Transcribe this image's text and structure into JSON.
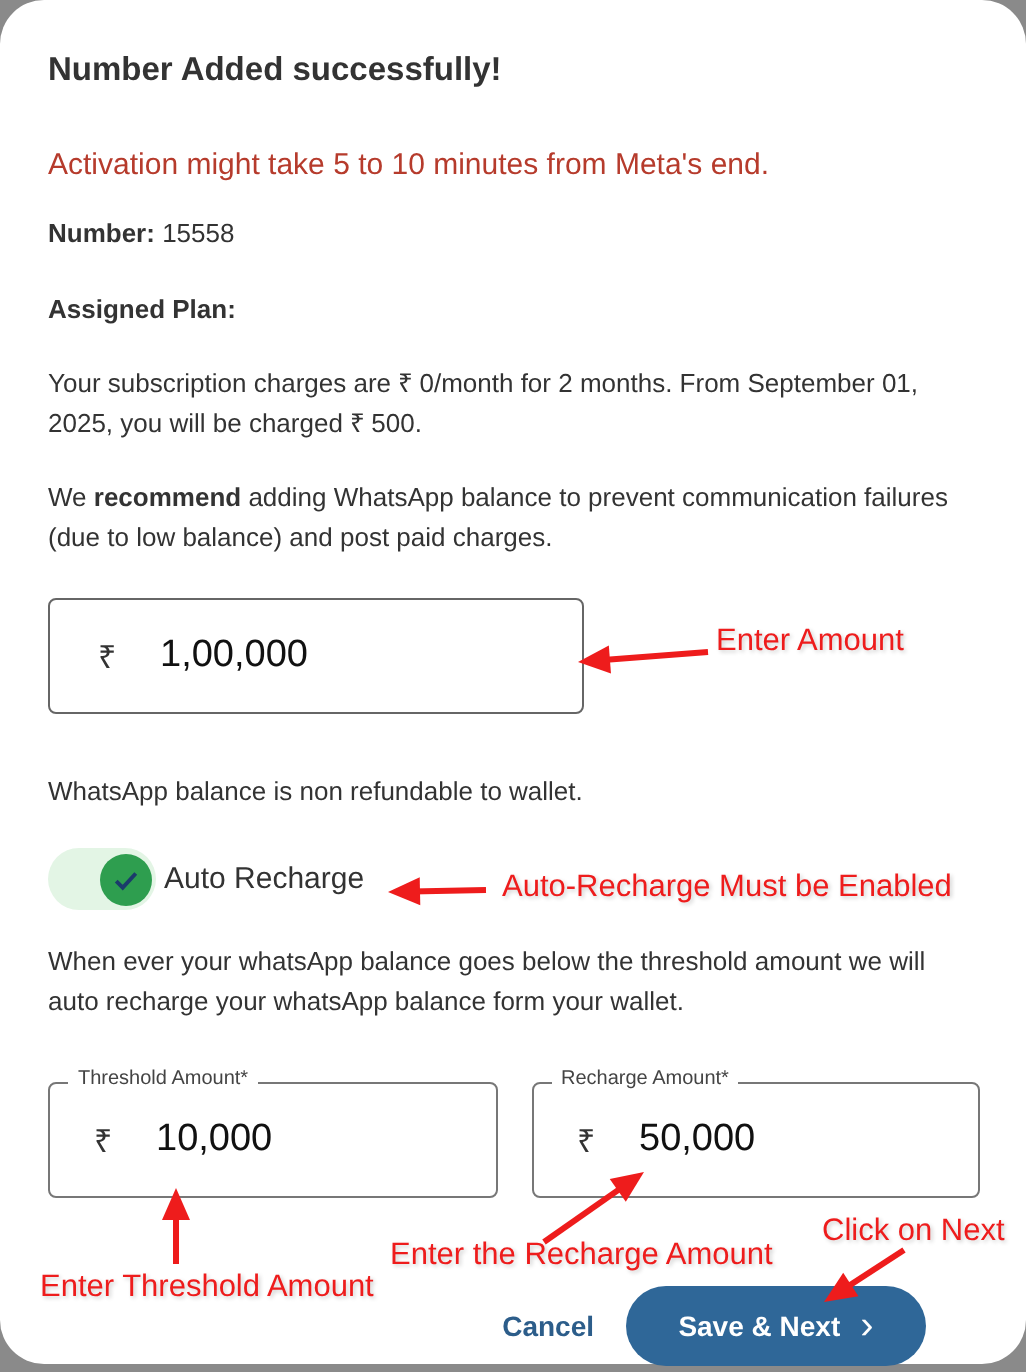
{
  "dialog": {
    "title": "Number Added successfully!",
    "notice": "Activation might take 5 to 10 minutes from Meta's end.",
    "number": "**Number:** 15558",
    "plan_label": "Assigned Plan:",
    "subscription_text": "Your subscription charges are ₹ 0/month for 2 months. From September 01, 2025, you will be charged ₹ 500.",
    "recommend_text": "We **recommend** adding WhatsApp balance to prevent communication failures (due to low balance) and post paid charges.",
    "amount_field": {
      "currency": "₹",
      "value": "1,00,000"
    },
    "refund_note": "WhatsApp balance is non refundable to wallet.",
    "auto_recharge": {
      "label": "Auto Recharge",
      "on": true
    },
    "auto_recharge_note": "When ever your whatsApp balance goes below the threshold amount we will auto recharge your whatsApp balance form your wallet.",
    "fields": [
      {
        "label": "Threshold Amount*",
        "currency": "₹",
        "value": "10,000"
      },
      {
        "label": "Recharge Amount*",
        "currency": "₹",
        "value": "50,000"
      }
    ],
    "buttons": {
      "cancel": "Cancel",
      "save": "Save & Next",
      "save_icon": "›"
    }
  },
  "annotations": [
    {
      "text": "Enter Amount"
    },
    {
      "text": "Auto-Recharge Must be Enabled"
    },
    {
      "text": "Enter Threshold Amount"
    },
    {
      "text": "Enter the Recharge Amount"
    },
    {
      "text": "Click on Next"
    }
  ]
}
